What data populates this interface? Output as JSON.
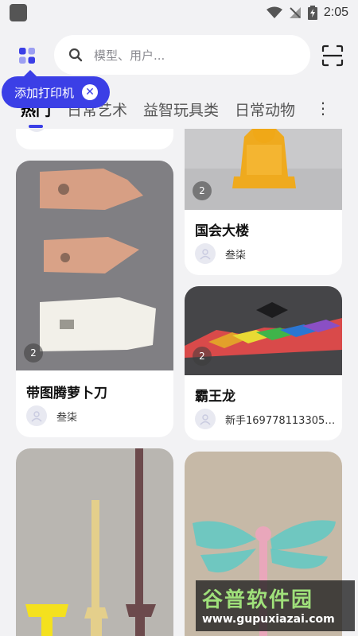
{
  "status_bar": {
    "time": "2:05"
  },
  "search": {
    "placeholder": "模型、用户..."
  },
  "tooltip": {
    "text": "添加打印机"
  },
  "tabs": [
    {
      "label": "热门",
      "active": true
    },
    {
      "label": "日常艺术"
    },
    {
      "label": "益智玩具类"
    },
    {
      "label": "日常动物"
    }
  ],
  "cards": [
    {
      "title": "带图腾萝卜刀",
      "count": "2",
      "author": "叁柒"
    },
    {
      "title": "国会大楼",
      "count": "2",
      "author": "叁柒"
    },
    {
      "title": "霸王龙",
      "count": "2",
      "author": "新手16977811330553..."
    }
  ],
  "watermark": {
    "title": "谷普软件园",
    "url": "www.gupuxiazai.com"
  },
  "colors": {
    "accent": "#3b3fe6",
    "background": "#f2f2f4"
  }
}
